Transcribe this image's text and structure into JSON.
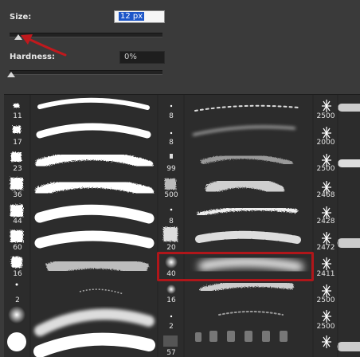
{
  "size": {
    "label": "Size:",
    "value": "12 px"
  },
  "hardness": {
    "label": "Hardness:",
    "value": "0%"
  },
  "brush_grid": {
    "col1": [
      "11",
      "17",
      "23",
      "36",
      "44",
      "60",
      "16",
      "2",
      "",
      ""
    ],
    "col2": [
      "8",
      "8",
      "99",
      "500",
      "8",
      "20",
      "40",
      "16",
      "2",
      "57"
    ],
    "col3": [
      "2500",
      "2000",
      "2500",
      "2468",
      "2428",
      "2472",
      "2411",
      "2500",
      "2500",
      ""
    ]
  }
}
